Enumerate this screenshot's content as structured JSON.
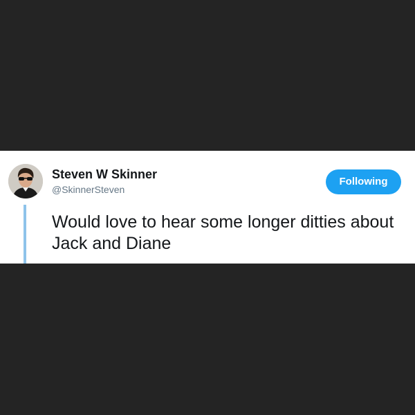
{
  "tweet": {
    "display_name": "Steven W Skinner",
    "handle": "@SkinnerSteven",
    "follow_button_label": "Following",
    "text": "Would love to hear some longer ditties about Jack and Diane",
    "avatar_icon": "user-avatar-photo"
  },
  "colors": {
    "background": "#242424",
    "card": "#ffffff",
    "accent": "#1da1f2",
    "thread_line": "#8ec3ea",
    "name_text": "#14171a",
    "handle_text": "#657786"
  }
}
